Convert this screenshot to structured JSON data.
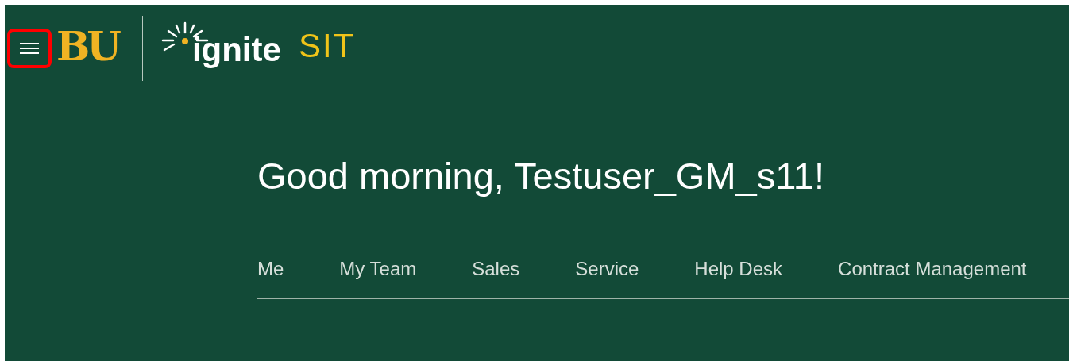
{
  "header": {
    "menu_button": {
      "highlighted": true
    },
    "logo_text": "BU",
    "app_name": "ignite",
    "environment": "SIT"
  },
  "greeting": "Good morning, Testuser_GM_s11!",
  "tabs": [
    {
      "label": "Me",
      "selected": false
    },
    {
      "label": "My Team",
      "selected": false
    },
    {
      "label": "Sales",
      "selected": false
    },
    {
      "label": "Service",
      "selected": false
    },
    {
      "label": "Help Desk",
      "selected": false
    },
    {
      "label": "Contract Management",
      "selected": false
    }
  ]
}
